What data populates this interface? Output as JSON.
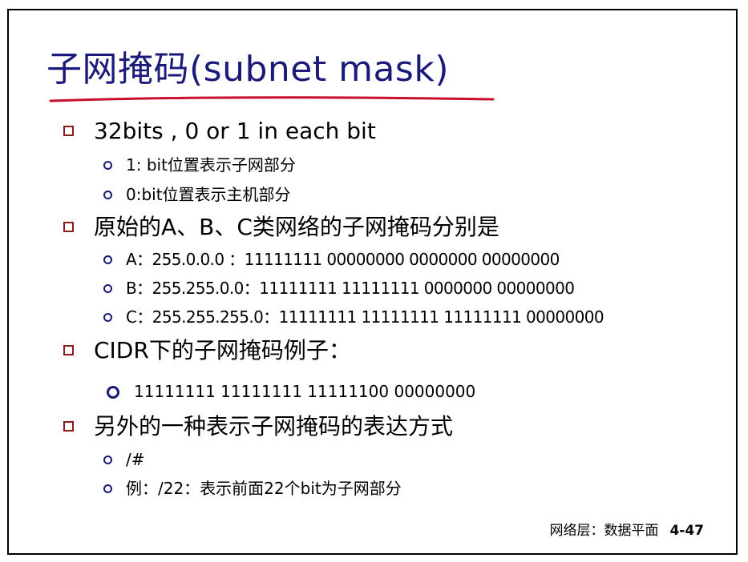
{
  "title": "子网掩码(subnet mask)",
  "bullets": [
    {
      "text": "32bits , 0 or 1 in each bit",
      "sub": [
        "1: bit位置表示子网部分",
        "0:bit位置表示主机部分"
      ]
    },
    {
      "text": "原始的A、B、C类网络的子网掩码分别是",
      "sub": [
        "A：255.0.0.0 ：11111111 00000000 0000000 00000000",
        "B：255.255.0.0：11111111 11111111 0000000 00000000",
        "C：255.255.255.0：11111111 11111111 11111111 00000000"
      ]
    },
    {
      "text": "CIDR下的子网掩码例子：",
      "sub": [
        "11111111 11111111 11111100 00000000"
      ]
    },
    {
      "text": "另外的一种表示子网掩码的表达方式",
      "sub": [
        "/#",
        "例：/22：表示前面22个bit为子网部分"
      ]
    }
  ],
  "footer": {
    "section": "网络层：数据平面",
    "page": "4-47"
  },
  "colors": {
    "title": "#1a1a7a",
    "underline": "#c8102e",
    "square_bullet": "#8b1a1a",
    "circle_bullet": "#1a1a7a"
  },
  "icons": {
    "level1": "hollow-square-bullet-icon",
    "level2": "hollow-circle-bullet-icon"
  }
}
